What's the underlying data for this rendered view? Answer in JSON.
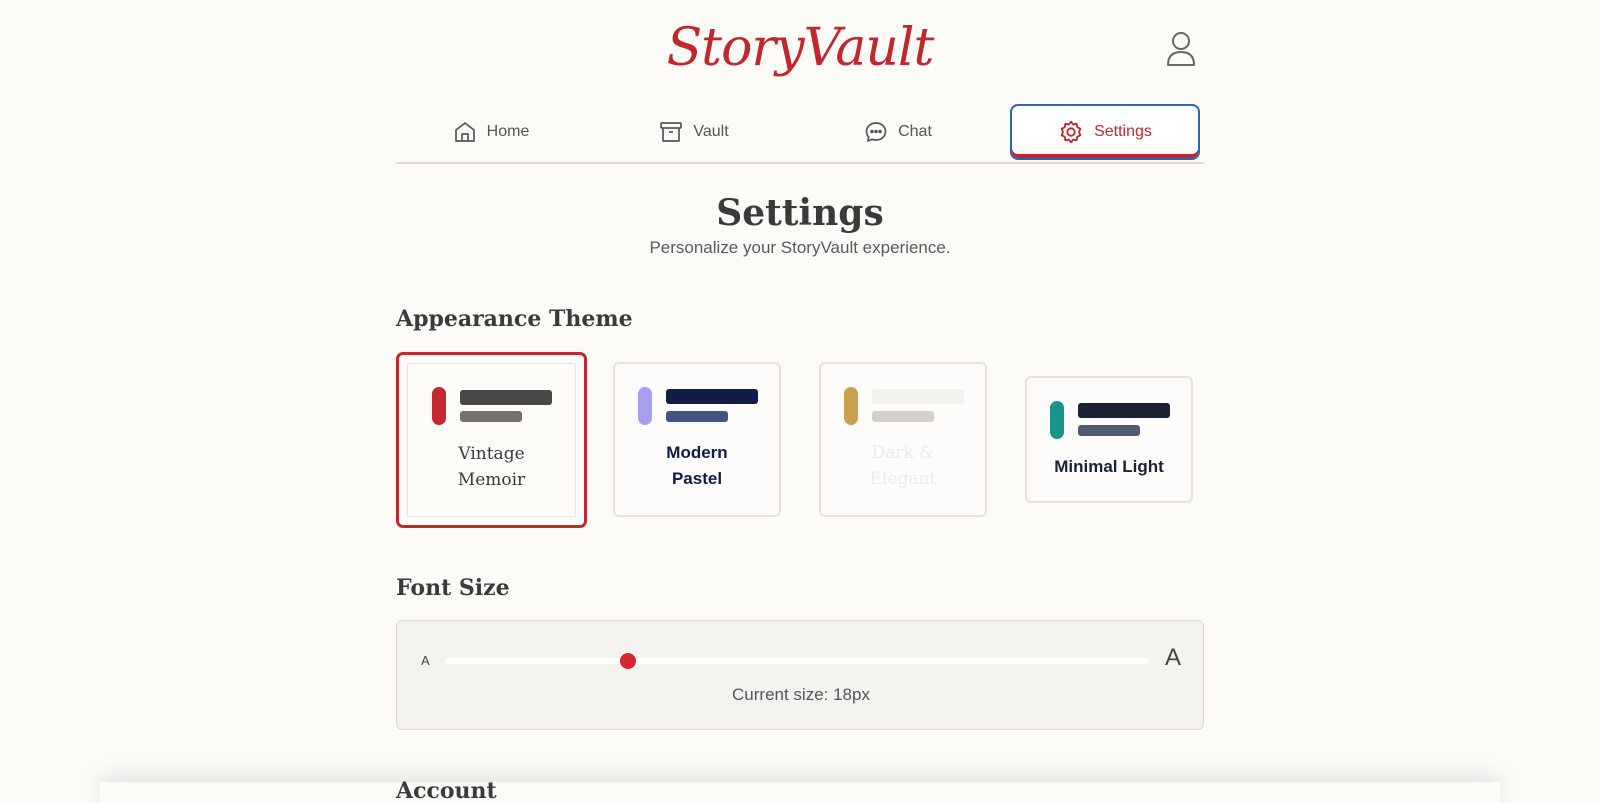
{
  "app": {
    "logo": "StoryVault"
  },
  "nav": {
    "tabs": [
      {
        "label": "Home",
        "icon": "home-icon"
      },
      {
        "label": "Vault",
        "icon": "archive-icon"
      },
      {
        "label": "Chat",
        "icon": "chat-bubble-icon"
      },
      {
        "label": "Settings",
        "icon": "gear-icon",
        "active": true
      }
    ]
  },
  "page": {
    "title": "Settings",
    "subtitle": "Personalize your StoryVault experience."
  },
  "appearance": {
    "heading": "Appearance Theme",
    "themes": [
      {
        "name_line1": "Vintage",
        "name_line2": "Memoir",
        "selected": true,
        "colors": {
          "swatch": "#c4282e",
          "bar1": "#474747",
          "bar2": "#76716a",
          "text": "#3a3a3a"
        }
      },
      {
        "name_line1": "Modern",
        "name_line2": "Pastel",
        "selected": false,
        "colors": {
          "swatch": "#a79ef2",
          "bar1": "#111d45",
          "bar2": "#3f5484",
          "text": "#111d45"
        }
      },
      {
        "name_line1": "Dark &",
        "name_line2": "Elegant",
        "selected": false,
        "colors": {
          "swatch": "#caa24e",
          "bar1": "#f2f1ee",
          "bar2": "#d4cfca",
          "text": "#ecebe8"
        }
      },
      {
        "name": "Minimal Light",
        "selected": false,
        "colors": {
          "swatch": "#16948b",
          "bar1": "#1a2233",
          "bar2": "#515b71",
          "text": "#1a2233"
        }
      }
    ]
  },
  "font_size": {
    "heading": "Font Size",
    "small_label": "A",
    "large_label": "A",
    "current_text": "Current size: 18px",
    "value_fraction": 0.26,
    "accent": "#d0282e"
  },
  "account": {
    "heading": "Account"
  },
  "colors": {
    "brand": "#c0282e",
    "focus": "#2f63b6",
    "background": "#fcfbf8"
  }
}
